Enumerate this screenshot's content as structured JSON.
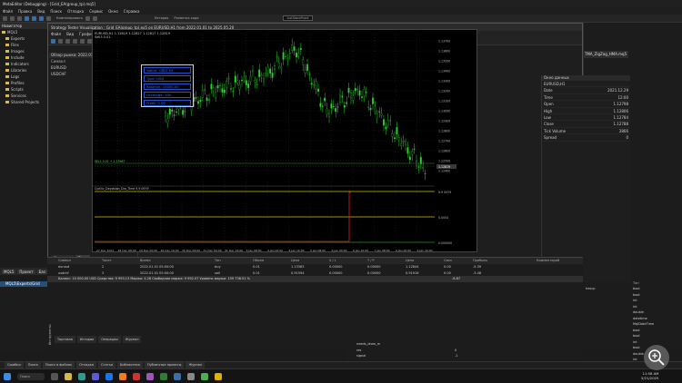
{
  "app": {
    "title": "MetaEditor (Debugging) - [Grid_EA(group_tp).mq5]"
  },
  "menu": [
    "Файл",
    "Правка",
    "Вид",
    "Поиск",
    "Отладка",
    "Сервис",
    "Окно",
    "Справка"
  ],
  "toolbar": {
    "compile_label": "Компилировать",
    "history_label": "История",
    "replace_label": "Разметка кода",
    "symbol_value": "ListStackRock"
  },
  "navigator": {
    "title": "Навигатор",
    "root": "MQL5",
    "items": [
      "Experts",
      "Files",
      "Images",
      "Include",
      "Indicators",
      "Libraries",
      "Logs",
      "Profiles",
      "Scripts",
      "Services",
      "Shared Projects"
    ],
    "tabs": [
      "MQL5",
      "Проект",
      "Баз"
    ],
    "tree_selected": "MQL5\\Experts\\Grid"
  },
  "tester_window": {
    "title": "Strategy Tester Visualization : Grid_EA(group_tp).ex5 on EURUSD,H1 from 2022.01.01 to 2025.05.20",
    "menu": [
      "Файл",
      "Вид",
      "Графики",
      "Тестирование",
      "Сервис",
      "Справка"
    ],
    "scroll_label": "Прокрутить до",
    "date_value": "2022.01.01 12:00"
  },
  "market_watch": {
    "title": "Обзор рынка: 2022.01.03",
    "cols": [
      "Символ",
      "Bid",
      "Ask"
    ],
    "rows": [
      {
        "symbol": "EURUSD",
        "bid": "1.13690",
        "ask": "1.13682"
      },
      {
        "symbol": "USDCHF",
        "bid": "0.91840",
        "ask": "0.91826"
      }
    ],
    "tabs": [
      "Символы",
      "Тики"
    ]
  },
  "chart": {
    "header": "EURUSD,H1 1.12819 1.12827 1.12817 1.12819",
    "subheader": "Sell3 0.01",
    "indicator_label": "Cyrillic_Deviation_Dra_Time 9.9 0979",
    "sell_line_label": "SELL 0.01 → 1.13967",
    "price_labels": [
      "1.13700",
      "1.13600",
      "1.13500",
      "1.13400",
      "1.13300",
      "1.13200",
      "1.13100",
      "1.13000",
      "1.12900",
      "1.12800",
      "1.12700",
      "1.12600",
      "1.12500",
      "1.12400"
    ],
    "current_price": "1.12819",
    "sub_labels": [
      "9.9 0979",
      "0.0004",
      "0.000000"
    ],
    "time_labels": [
      "27 Dec 2021",
      "28 Dec 08:00",
      "29 Dec 00:00",
      "29 Dec 16:00",
      "30 Dec 08:00",
      "31 Dec 00:00",
      "31 Dec 16:00",
      "3 Jan 08:00",
      "4 Jan 00:00",
      "4 Jan 16:00",
      "5 Jan 08:00",
      "6 Jan 00:00",
      "6 Jan 16:00",
      "7 Jan 08:00",
      "9 Jan 00:00",
      "9 Jan 16:00"
    ]
  },
  "info_box": {
    "name": "Name: GRID EA",
    "type": "Type: USD",
    "balance": "Balance: 10000.00",
    "leverage": "Leverage: 100",
    "profit": "Profit: 0.00"
  },
  "data_window": {
    "title": "Окно данных",
    "symbol": "EURUSD,H1",
    "rows": [
      {
        "k": "Date",
        "v": "2021.12.29"
      },
      {
        "k": "Time",
        "v": "12:00"
      },
      {
        "k": "Open",
        "v": "1.12798"
      },
      {
        "k": "High",
        "v": "1.12806"
      },
      {
        "k": "Low",
        "v": "1.12784"
      },
      {
        "k": "Close",
        "v": "1.12788"
      },
      {
        "k": "Tick Volume",
        "v": "2866"
      },
      {
        "k": "Spread",
        "v": "0"
      }
    ]
  },
  "right_panel": {
    "tab": "TMA_ZigZag_HMA.mq5",
    "vars": [
      {
        "name": "hexcp",
        "type": "bool"
      },
      {
        "name": "",
        "type": "bool"
      },
      {
        "name": "",
        "type": "int"
      },
      {
        "name": "",
        "type": "int"
      },
      {
        "name": "",
        "type": "double"
      },
      {
        "name": "",
        "type": "datetime"
      },
      {
        "name": "",
        "type": "MqlDateTime"
      },
      {
        "name": "",
        "type": "bool"
      },
      {
        "name": "",
        "type": "bool"
      },
      {
        "name": "",
        "type": "int"
      },
      {
        "name": "",
        "type": "bool"
      },
      {
        "name": "",
        "type": "double"
      },
      {
        "name": "",
        "type": "int"
      }
    ],
    "header": "Тип"
  },
  "toolbox": {
    "cols": [
      "Символ",
      "Тикет",
      "Время",
      "Тип",
      "Объем",
      "Цена",
      "S / L",
      "T / P",
      "Цена",
      "Своп",
      "Прибыль",
      "Комментарий"
    ],
    "rows": [
      {
        "s": "eurusd",
        "t": "2",
        "time": "2022.01.01 05:00:00",
        "type": "buy",
        "vol": "0.01",
        "price": "1.13383",
        "sl": "0.00000",
        "tp": "0.00000",
        "cur": "1.12844",
        "swap": "0.00",
        "profit": "-5.39"
      },
      {
        "s": "usdchf",
        "t": "3",
        "time": "2022.01.01 05:00:00",
        "type": "sell",
        "vol": "0.01",
        "price": "0.91594",
        "sl": "0.00000",
        "tp": "0.00000",
        "cur": "0.91916",
        "swap": "0.00",
        "profit": "-3.48"
      }
    ],
    "balance": "Баланс: 10 000.00 USD  Средства: 9 993.13  Маржа: 4.28  Свободная маржа: 9 992.07  Уровень маржи: 159 738.51 %",
    "balance_profit": "-6.87",
    "tabs": [
      "Торговля",
      "История",
      "Операции",
      "Журнал"
    ],
    "side_label": "Инструменты"
  },
  "watch": {
    "rows": [
      {
        "k": "needs_draw_m",
        "v": ""
      },
      {
        "k": "res",
        "v": "0"
      },
      {
        "k": "signal",
        "v": "-1"
      }
    ]
  },
  "bottom_tabs": [
    "Ошибки",
    "Поиск",
    "Поиск в файлах",
    "Отладка",
    "Статьи",
    "Библиотека",
    "Публичные проекты",
    "Журнал"
  ],
  "taskbar": {
    "search": "Поиск",
    "time": "11:58 AM",
    "date": "5/21/2025"
  }
}
